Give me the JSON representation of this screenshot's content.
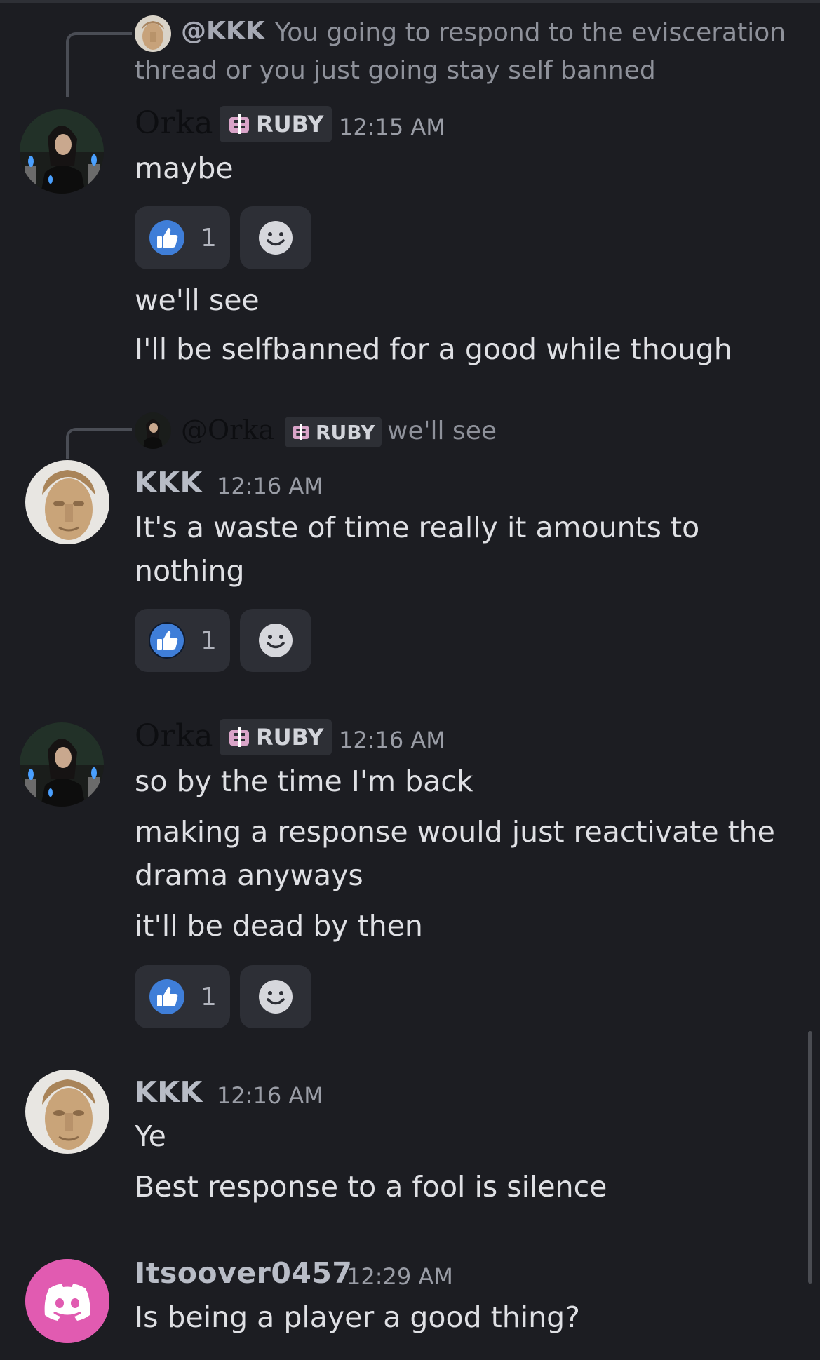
{
  "colors": {
    "background": "#1c1d22",
    "reaction_bg": "#2d2f36",
    "like_blue": "#3f7ed8",
    "discord_pink": "#e15bb1"
  },
  "messages": [
    {
      "reply": {
        "name": "@KKK",
        "text_line1": "You going to respond to the evisceration",
        "text_line2": "thread or you just going stay self banned"
      },
      "author": "Orka",
      "badge": "RUBY",
      "time": "12:15 AM",
      "lines": [
        "maybe"
      ],
      "reaction": {
        "icon": "thumbs-up",
        "count": "1"
      }
    },
    {
      "author": "Orka",
      "lines": [
        "we'll see",
        "I'll be selfbanned for a good while though"
      ]
    },
    {
      "reply": {
        "name": "@Orka",
        "badge": "RUBY",
        "text": "we'll see"
      },
      "author": "KKK",
      "time": "12:16 AM",
      "lines": [
        "It's a waste of time really it amounts to",
        "nothing"
      ],
      "reaction": {
        "icon": "thumbs-up",
        "count": "1"
      }
    },
    {
      "author": "Orka",
      "badge": "RUBY",
      "time": "12:16 AM",
      "lines": [
        "so by the time I'm back",
        "making a response would just reactivate the",
        "drama anyways",
        "it'll be dead by then"
      ],
      "reaction": {
        "icon": "thumbs-up",
        "count": "1"
      }
    },
    {
      "author": "KKK",
      "time": "12:16 AM",
      "lines": [
        "Ye",
        "Best response to a fool is silence"
      ]
    },
    {
      "author": "Itsoover0457",
      "time": "12:29 AM",
      "lines": [
        "Is being a player a good thing?"
      ]
    }
  ]
}
